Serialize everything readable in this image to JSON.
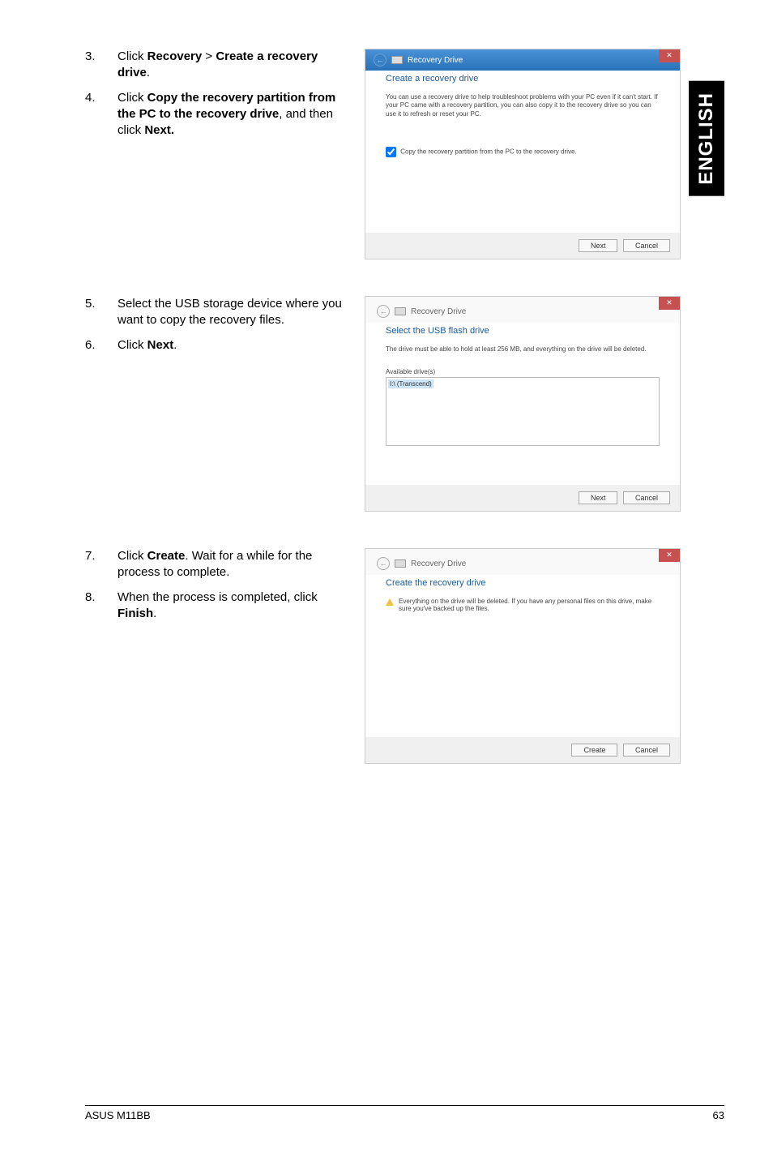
{
  "sideTab": "ENGLISH",
  "steps": {
    "s3_num": "3.",
    "s3_a": "Click ",
    "s3_b": "Recovery",
    "s3_c": " > ",
    "s3_d": "Create a recovery drive",
    "s3_e": ".",
    "s4_num": "4.",
    "s4_a": "Click ",
    "s4_b": "Copy the recovery partition from the PC to the recovery drive",
    "s4_c": ", and then click ",
    "s4_d": "Next.",
    "s5_num": "5.",
    "s5_text": "Select the USB storage device where you want to copy the recovery files.",
    "s6_num": "6.",
    "s6_a": "Click ",
    "s6_b": "Next",
    "s6_c": ".",
    "s7_num": "7.",
    "s7_a": "Click ",
    "s7_b": "Create",
    "s7_c": ". Wait for a while for the process to complete.",
    "s8_num": "8.",
    "s8_a": "When the process is completed, click ",
    "s8_b": "Finish",
    "s8_c": "."
  },
  "dialog1": {
    "breadcrumb": "Recovery Drive",
    "title": "Create a recovery drive",
    "body": "You can use a recovery drive to help troubleshoot problems with your PC even if it can't start. If your PC came with a recovery partition, you can also copy it to the recovery drive so you can use it to refresh or reset your PC.",
    "checkLabel": "Copy the recovery partition from the PC to the recovery drive.",
    "btnNext": "Next",
    "btnCancel": "Cancel"
  },
  "dialog2": {
    "breadcrumb": "Recovery Drive",
    "title": "Select the USB flash drive",
    "body": "The drive must be able to hold at least 256 MB, and everything on the drive will be deleted.",
    "availLabel": "Available drive(s)",
    "driveItem": "I:\\ (Transcend)",
    "btnNext": "Next",
    "btnCancel": "Cancel"
  },
  "dialog3": {
    "breadcrumb": "Recovery Drive",
    "title": "Create the recovery drive",
    "warn": "Everything on the drive will be deleted. If you have any personal files on this drive, make sure you've backed up the files.",
    "btnCreate": "Create",
    "btnCancel": "Cancel"
  },
  "footer": {
    "left": "ASUS M11BB",
    "right": "63"
  }
}
